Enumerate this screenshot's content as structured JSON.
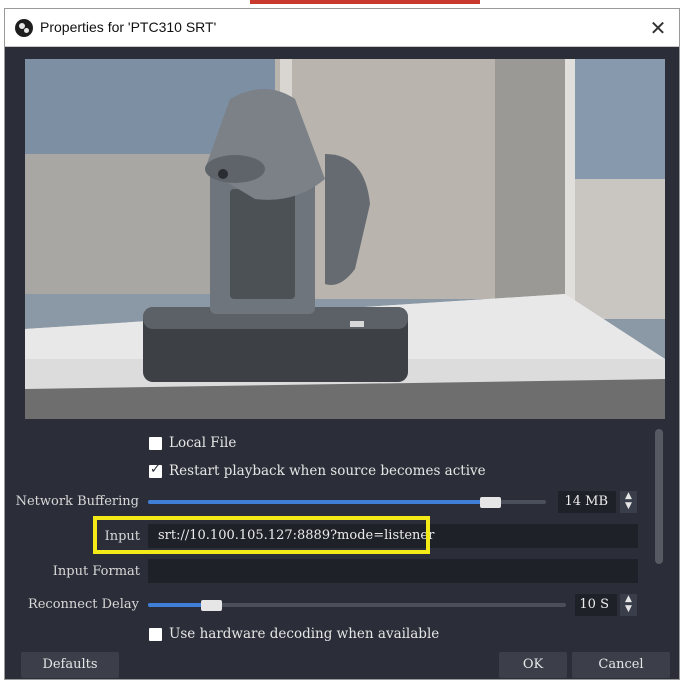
{
  "window": {
    "title": "Properties for 'PTC310 SRT'",
    "close_glyph": "✕"
  },
  "preview": {
    "description_icon": "camera-preview"
  },
  "options": {
    "local_file": {
      "label": "Local File",
      "checked": false
    },
    "restart_playback": {
      "label": "Restart playback when source becomes active",
      "checked": true
    },
    "network_buffering": {
      "label": "Network Buffering",
      "value": "14 MB",
      "fill": 0.86
    },
    "input": {
      "label": "Input",
      "value": "srt://10.100.105.127:8889?mode=listener"
    },
    "input_format": {
      "label": "Input Format",
      "value": ""
    },
    "reconnect_delay": {
      "label": "Reconnect Delay",
      "value": "10 S",
      "fill": 0.15
    },
    "hw_decoding": {
      "label": "Use hardware decoding when available",
      "checked": false
    }
  },
  "buttons": {
    "defaults": "Defaults",
    "ok": "OK",
    "cancel": "Cancel"
  },
  "colors": {
    "dialog_bg": "#2b2e38",
    "accent": "#3f7fd8",
    "highlight": "#f3ea17"
  }
}
